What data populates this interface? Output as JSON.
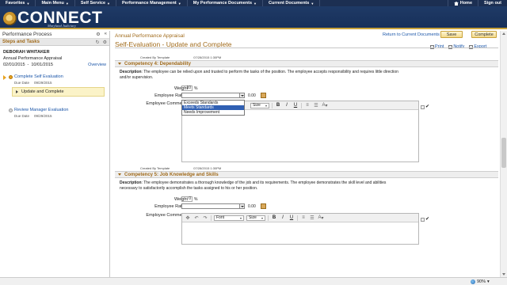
{
  "topnav": {
    "items": [
      "Favorites",
      "Main Menu",
      "Self Service",
      "Performance Management",
      "My Performance Documents",
      "Current Documents"
    ],
    "home": "Home",
    "signout": "Sign out"
  },
  "header": {
    "logo": "CONNECT",
    "subtitle": "Maryland Judiciary"
  },
  "left": {
    "title": "Performance Process",
    "steps_title": "Steps and Tasks",
    "employee_name": "DEBORAH WHITAKER",
    "document": "Annual Performance Appraisal",
    "start": "02/01/2015",
    "dash": "-",
    "end": "10/01/2015",
    "overview": "Overview",
    "steps": [
      {
        "name": "Complete Self Evaluation",
        "due_label": "Due Date",
        "due": "09/29/2015"
      },
      {
        "name": "Review Manager Evaluation",
        "due_label": "Due Date",
        "due": "09/29/2015"
      }
    ],
    "active_sub": "Update and Complete"
  },
  "main": {
    "doc_title": "Annual Performance Appraisal",
    "page_title": "Self-Evaluation - Update and Complete",
    "return_link": "Return to Current Documents",
    "save": "Save",
    "complete": "Complete",
    "actions": {
      "print": "Print",
      "notify": "Notify",
      "export": "Export"
    },
    "meta": {
      "created_by": "Created By Template",
      "created_on": "07/28/2015 1:30PM"
    },
    "sections": [
      {
        "header": "Competency 4: Dependability",
        "desc_label": "Description",
        "desc": ": The employee can be relied upon and trusted to perform the tasks of the position. The employee accepts responsibility and requires little direction and/or supervision.",
        "weight_label": "Weight",
        "weight": "10",
        "pct": "%",
        "rating_label": "Employee Rating",
        "score": "0.00",
        "comments_label": "Employee Comments",
        "options": [
          "Exceeds Standards",
          "Meets Standards",
          "Needs Improvement"
        ],
        "selected_option": "Meets Standards"
      },
      {
        "header": "Competency 5: Job Knowledge and Skills",
        "desc_label": "Description",
        "desc": ": The employee demonstrates a thorough knowledge of the job and its requirements. The employee demonstrates the skill level and abilities necessary to satisfactorily accomplish the tasks assigned to his or her position.",
        "weight_label": "Weight",
        "weight": "0",
        "pct": "%",
        "rating_label": "Employee Rating",
        "score": "0.00",
        "comments_label": "Employee Comments"
      }
    ],
    "toolbar": {
      "font": "Font",
      "size": "Size",
      "bold": "B",
      "italic": "I",
      "underline": "U",
      "color": "A"
    }
  },
  "status": {
    "zoom": "90%"
  }
}
